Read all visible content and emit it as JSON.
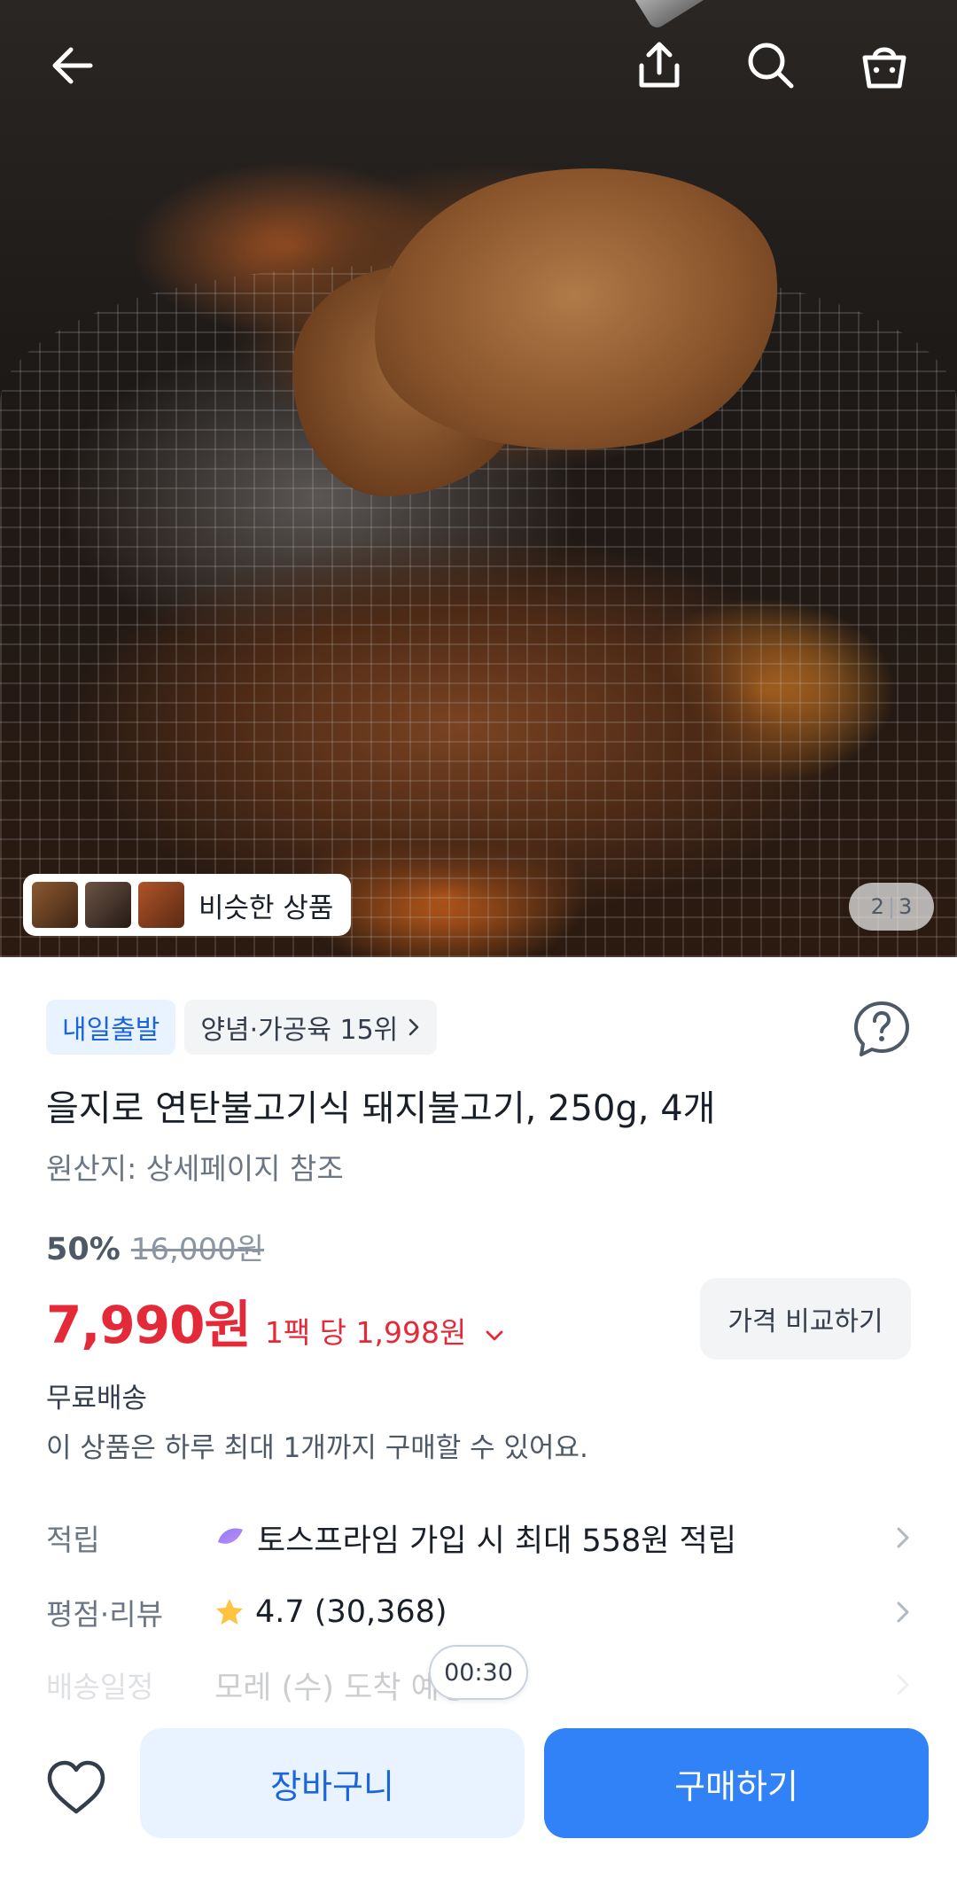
{
  "product_image": {
    "similar_label": "비슷한 상품",
    "page_current": "2",
    "page_total": "3"
  },
  "badges": {
    "shipping": "내일출발",
    "rank": "양념·가공육 15위"
  },
  "product": {
    "title": "을지로 연탄불고기식 돼지불고기, 250g, 4개",
    "origin": "원산지: 상세페이지 참조",
    "discount_rate": "50%",
    "original_price": "16,000원",
    "price": "7,990원",
    "unit_price": "1팩 당 1,998원",
    "compare_button": "가격 비교하기",
    "free_shipping": "무료배송",
    "purchase_limit": "이 상품은 하루 최대 1개까지 구매할 수 있어요."
  },
  "details": {
    "points_label": "적립",
    "points_value": "토스프라임 가입 시 최대 558원 적립",
    "rating_label": "평점·리뷰",
    "rating_value": "4.7 (30,368)",
    "delivery_label": "배송일정",
    "delivery_value": "모레 (수) 도착 예정"
  },
  "timer": "00:30",
  "actions": {
    "cart": "장바구니",
    "buy": "구매하기"
  },
  "colors": {
    "accent_blue": "#3182f6",
    "price_red": "#e42939"
  }
}
